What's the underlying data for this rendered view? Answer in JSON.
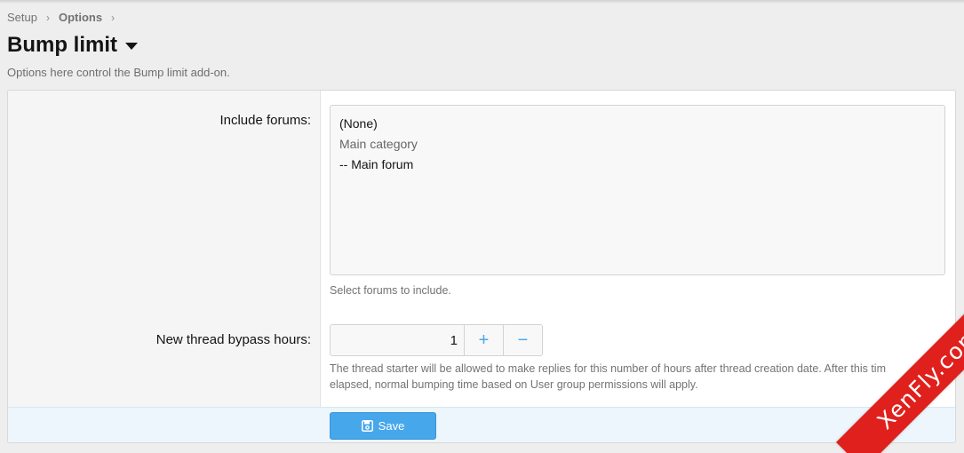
{
  "breadcrumb": {
    "items": [
      "Setup",
      "Options"
    ]
  },
  "page": {
    "title": "Bump limit",
    "description": "Options here control the Bump limit add-on."
  },
  "include_forums": {
    "label": "Include forums:",
    "options": [
      {
        "text": "(None)",
        "kind": "option"
      },
      {
        "text": "Main category",
        "kind": "group"
      },
      {
        "text": "-- Main forum",
        "kind": "option"
      }
    ],
    "hint": "Select forums to include."
  },
  "bypass_hours": {
    "label": "New thread bypass hours:",
    "value": "1",
    "increment_icon": "plus-icon",
    "decrement_icon": "minus-icon",
    "hint_line1": "The thread starter will be allowed to make replies for this number of hours after thread creation date. After this tim",
    "hint_line2": "elapsed, normal bumping time based on User group permissions will apply."
  },
  "footer": {
    "save_label": "Save",
    "save_icon": "floppy-disk-icon"
  },
  "watermark": {
    "text": "XenFly.com",
    "color": "#e0201c"
  },
  "colors": {
    "accent": "#47a7eb",
    "footer_bg": "#edf6fd"
  }
}
